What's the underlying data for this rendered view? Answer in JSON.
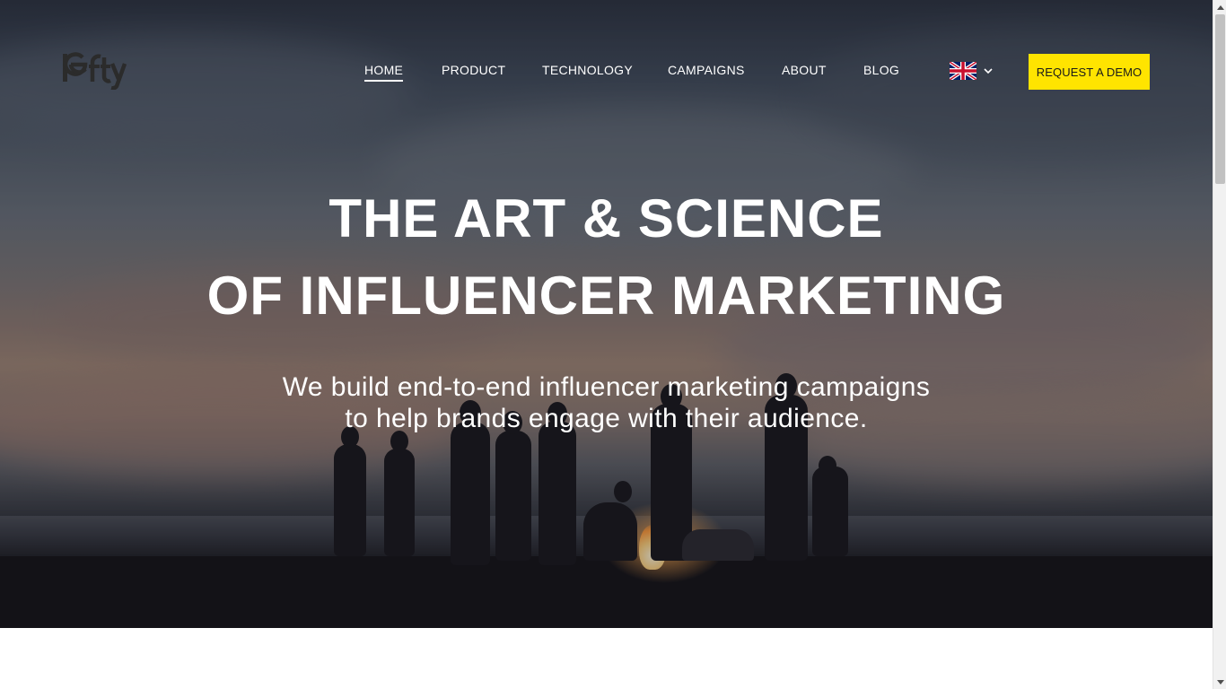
{
  "brand": {
    "logo_text": "lefty"
  },
  "nav": {
    "items": [
      {
        "label": "HOME",
        "active": true
      },
      {
        "label": "PRODUCT",
        "active": false
      },
      {
        "label": "TECHNOLOGY",
        "active": false
      },
      {
        "label": "CAMPAIGNS",
        "active": false
      },
      {
        "label": "ABOUT",
        "active": false
      },
      {
        "label": "BLOG",
        "active": false
      }
    ]
  },
  "language": {
    "selected_icon": "uk-flag-icon",
    "dropdown_icon": "chevron-down-icon"
  },
  "cta": {
    "label": "REQUEST A DEMO",
    "color": "#ffe400"
  },
  "hero": {
    "headline_line1": "THE ART & SCIENCE",
    "headline_line2": "OF INFLUENCER MARKETING",
    "subtitle_line1": "We build end-to-end influencer marketing campaigns",
    "subtitle_line2": "to help brands engage with their audience."
  }
}
